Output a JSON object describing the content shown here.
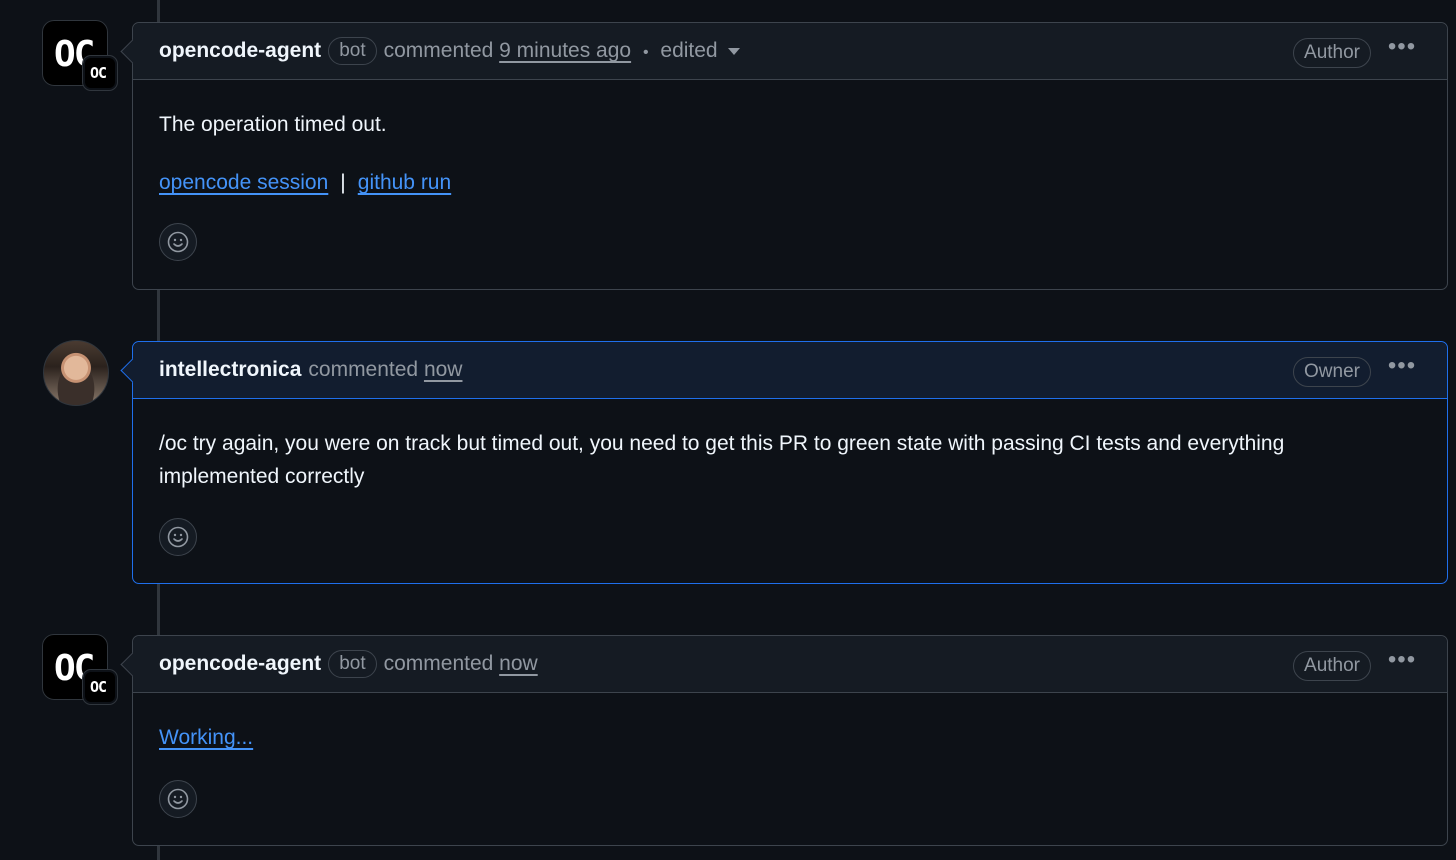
{
  "comments": [
    {
      "author": "opencode-agent",
      "bot_label": "bot",
      "action": "commented",
      "time": "9 minutes ago",
      "edited_sep": "•",
      "edited": "edited",
      "role": "Author",
      "avatar_text": "OC",
      "avatar_badge": "OC",
      "body": "The operation timed out.",
      "link1": "opencode session",
      "link_sep": "|",
      "link2": "github run",
      "menu": "•••",
      "reaction_icon": "smiley-icon"
    },
    {
      "author": "intellectronica",
      "action": "commented",
      "time": "now",
      "role": "Owner",
      "body": "/oc try again, you were on track but timed out, you need to get this PR to green state with passing CI tests and everything implemented correctly",
      "menu": "•••",
      "reaction_icon": "smiley-icon"
    },
    {
      "author": "opencode-agent",
      "bot_label": "bot",
      "action": "commented",
      "time": "now",
      "role": "Author",
      "avatar_text": "OC",
      "avatar_badge": "OC",
      "body_link": "Working...",
      "menu": "•••",
      "reaction_icon": "smiley-icon"
    }
  ],
  "colors": {
    "background": "#0d1117",
    "link": "#4493f8",
    "owner_border": "#1f6feb"
  }
}
